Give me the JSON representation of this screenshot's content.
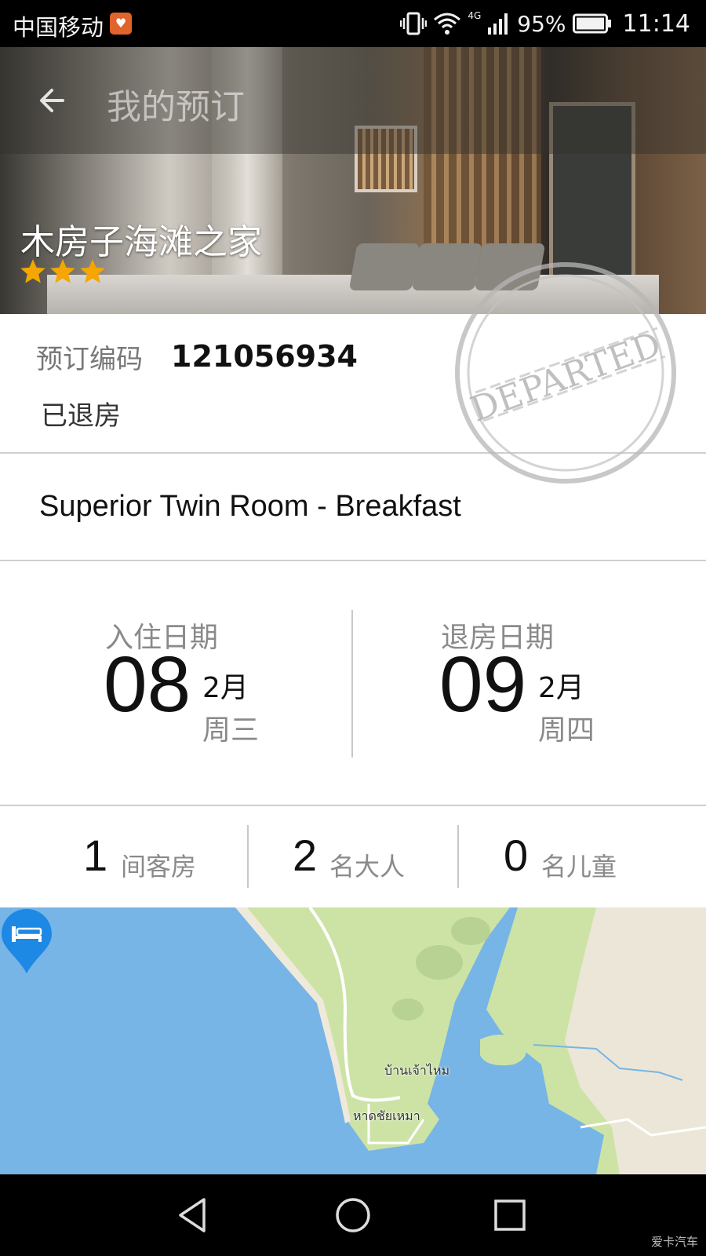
{
  "status_bar": {
    "carrier": "中国移动",
    "network": "4G",
    "battery": "95%",
    "time": "11:14"
  },
  "header": {
    "title": "我的预订"
  },
  "hotel": {
    "name": "木房子海滩之家",
    "stars": 3
  },
  "booking": {
    "code_label": "预订编码",
    "code_value": "121056934",
    "status": "已退房",
    "stamp_text": "DEPARTED"
  },
  "room": {
    "type": "Superior Twin Room - Breakfast"
  },
  "dates": {
    "checkin": {
      "label": "入住日期",
      "day": "08",
      "month": "2月",
      "weekday": "周三"
    },
    "checkout": {
      "label": "退房日期",
      "day": "09",
      "month": "2月",
      "weekday": "周四"
    }
  },
  "counts": [
    {
      "num": "1",
      "label": "间客房"
    },
    {
      "num": "2",
      "label": "名大人"
    },
    {
      "num": "0",
      "label": "名儿童"
    }
  ],
  "map": {
    "labels": [
      "บ้านเจ้าไหม",
      "หาดชัยเหมา"
    ],
    "pin_icon": "bed-icon"
  },
  "watermark": "爱卡汽车",
  "colors": {
    "star": "#f5a600",
    "pin": "#1e88e5",
    "water": "#76b5e6",
    "land": "#cde3a5"
  }
}
